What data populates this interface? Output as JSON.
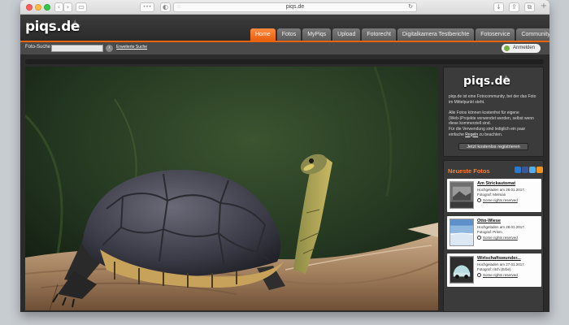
{
  "browser": {
    "address": "piqs.de",
    "back_icon": "chevron-left-icon",
    "forward_icon": "chevron-right-icon"
  },
  "header": {
    "logo": "piqs.de",
    "tabs": [
      {
        "label": "Home",
        "active": true
      },
      {
        "label": "Fotos",
        "active": false
      },
      {
        "label": "MyPiqs",
        "active": false
      },
      {
        "label": "Upload",
        "active": false
      },
      {
        "label": "Fotorecht",
        "active": false
      },
      {
        "label": "Digitalkamera Testberichte",
        "active": false
      },
      {
        "label": "Fotoservice",
        "active": false
      },
      {
        "label": "Community",
        "active": false
      }
    ],
    "accent_color": "#e8650f"
  },
  "searchbar": {
    "label": "Foto-Suche",
    "input_value": "",
    "advanced_link": "Erweiterte Suche",
    "login_label": "Anmelden"
  },
  "sidebar": {
    "intro": {
      "logo": "piqs.de",
      "paragraph1": "piqs.de ist eine Fotocommunity, bei der das Foto im Mittelpunkt steht.",
      "paragraph2": "Alle Fotos können kostenfrei für eigene (Web-)Projekte verwendet werden, selbst wenn diese kommerziell sind.",
      "paragraph3_pre": "Für die Verwendung sind lediglich ein paar einfache ",
      "paragraph3_link": "Regeln",
      "paragraph3_post": " zu beachten.",
      "register_button": "Jetzt kostenlos registrieren"
    },
    "newest": {
      "title": "Neueste Fotos",
      "items": [
        {
          "title": "Am Strickautomat",
          "uploaded": "Hochgeladen am 28.01.2017.",
          "photographer": "Fotograf: Melman",
          "rights": "Some rights reserved"
        },
        {
          "title": "Otto-Wiese",
          "uploaded": "Hochgeladen am 28.01.2017.",
          "photographer": "Fotograf: Prism",
          "rights": "Some rights reserved"
        },
        {
          "title": "Wirtschaftswunder...",
          "uploaded": "Hochgeladen am 27.01.2017.",
          "photographer": "Fotograf: ritch (Erbe)",
          "rights": "Some rights reserved"
        }
      ]
    }
  }
}
